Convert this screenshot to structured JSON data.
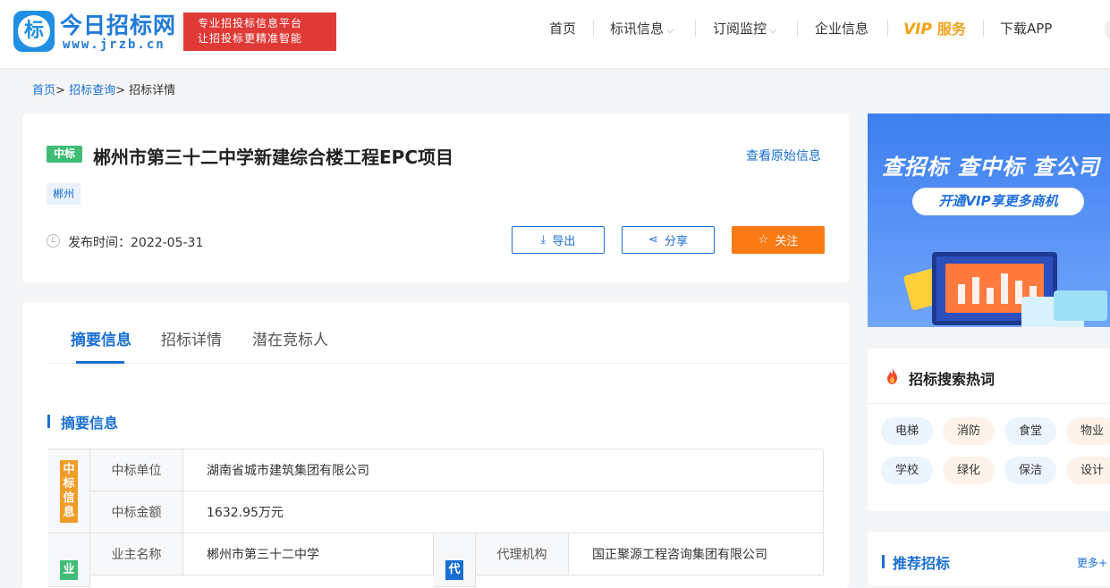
{
  "header": {
    "logo_glyph": "标",
    "logo_name": "今日招标网",
    "logo_domain": "www.jrzb.cn",
    "slogan_line1": "专业招投标信息平台",
    "slogan_line2": "让招投标更精准智能",
    "nav": {
      "home": "首页",
      "bid_info": "标讯信息",
      "subscribe": "订阅监控",
      "company": "企业信息",
      "vip_word": "VIP",
      "vip_service": "服务",
      "download": "下载APP"
    }
  },
  "breadcrumb": {
    "home": "首页",
    "search": "招标查询",
    "current": "招标详情",
    "sep": ">"
  },
  "detail": {
    "status_badge": "中标",
    "title": "郴州市第三十二中学新建综合楼工程EPC项目",
    "view_original": "查看原始信息",
    "region": "郴州",
    "publish_label": "发布时间：",
    "publish_date": "2022-05-31",
    "export_label": "导出",
    "share_label": "分享",
    "follow_label": "关注"
  },
  "tabs": {
    "summary": "摘要信息",
    "details": "招标详情",
    "competitors": "潜在竞标人"
  },
  "summary": {
    "section_title": "摘要信息",
    "win_group": "中标信息",
    "owner_group_char": "业",
    "agent_group_char": "代",
    "rows": {
      "winner_label": "中标单位",
      "winner_value": "湖南省城市建筑集团有限公司",
      "amount_label": "中标金额",
      "amount_value": "1632.95万元",
      "owner_label": "业主名称",
      "owner_value": "郴州市第三十二中学",
      "agent_label": "代理机构",
      "agent_value": "国正聚源工程咨询集团有限公司"
    }
  },
  "sidebar": {
    "banner_headline": "查招标 查中标 查公司",
    "banner_cta": "开通VIP享更多商机",
    "hot_title": "招标搜索热词",
    "hot_words": [
      "电梯",
      "消防",
      "食堂",
      "物业",
      "学校",
      "绿化",
      "保洁",
      "设计"
    ],
    "recommend_title": "推荐招标",
    "recommend_more": "更多+"
  },
  "colors": {
    "primary": "#1a6fd4",
    "success_badge": "#3fbd76",
    "follow_button": "#fa7a14",
    "win_group_tag": "#f29b27",
    "owner_group_tag": "#3fbd76",
    "agent_group_tag": "#1a6fd4",
    "vip": "#f5a012"
  }
}
